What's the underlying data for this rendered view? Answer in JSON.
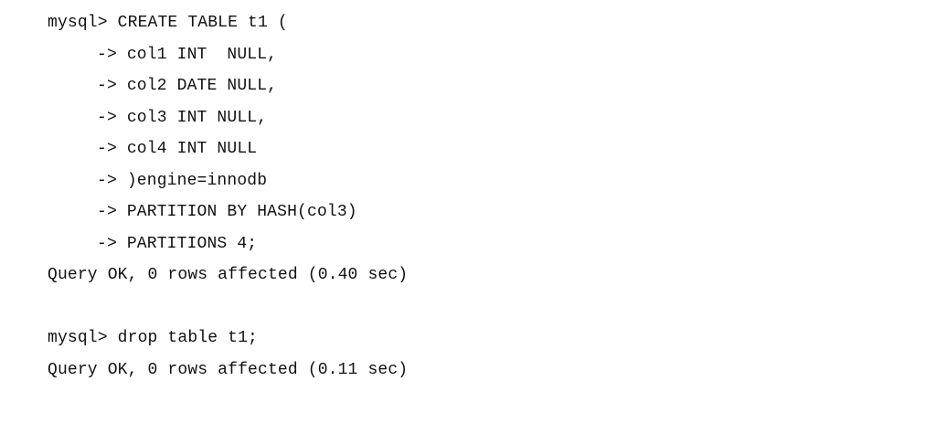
{
  "console": {
    "lines": [
      {
        "text": "mysql> CREATE TABLE t1 (",
        "indent": false
      },
      {
        "text": "-> col1 INT  NULL,",
        "indent": true
      },
      {
        "text": "-> col2 DATE NULL,",
        "indent": true
      },
      {
        "text": "-> col3 INT NULL,",
        "indent": true
      },
      {
        "text": "-> col4 INT NULL",
        "indent": true
      },
      {
        "text": "-> )engine=innodb",
        "indent": true
      },
      {
        "text": "-> PARTITION BY HASH(col3)",
        "indent": true
      },
      {
        "text": "-> PARTITIONS 4;",
        "indent": true
      },
      {
        "text": "Query OK, 0 rows affected (0.40 sec)",
        "indent": false
      },
      {
        "text": "",
        "indent": false
      },
      {
        "text": "mysql> drop table t1;",
        "indent": false
      },
      {
        "text": "Query OK, 0 rows affected (0.11 sec)",
        "indent": false
      }
    ]
  }
}
